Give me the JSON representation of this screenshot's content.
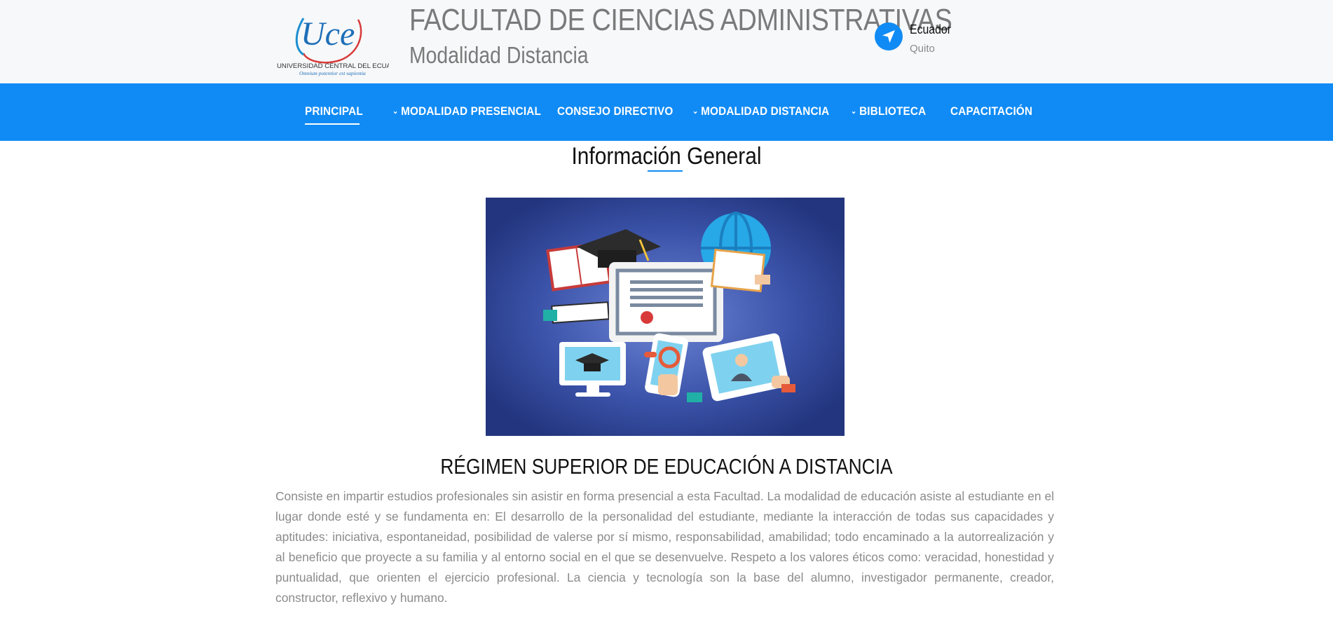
{
  "header": {
    "logo_text": "Uce",
    "logo_caption": "UNIVERSIDAD CENTRAL DEL ECUADOR",
    "logo_motto": "Omnium potentior est sapientia",
    "title": "FACULTAD DE CIENCIAS ADMINISTRATIVAS",
    "subtitle": "Modalidad Distancia",
    "location": {
      "country": "Ecuador",
      "city": "Quito",
      "icon": "navigation-arrow-icon"
    }
  },
  "nav": {
    "items": [
      {
        "label": "PRINCIPAL",
        "active": true,
        "dropdown": false
      },
      {
        "label": "MODALIDAD PRESENCIAL",
        "dropdown": true
      },
      {
        "label": "CONSEJO DIRECTIVO",
        "dropdown": false
      },
      {
        "label": "MODALIDAD DISTANCIA",
        "dropdown": true
      },
      {
        "label": "BIBLIOTECA",
        "dropdown": true
      },
      {
        "label": "CAPACITACIÓN",
        "dropdown": false
      }
    ],
    "chevron": "⌄"
  },
  "main": {
    "section_title": "Información General",
    "regimen_title": "RÉGIMEN SUPERIOR DE EDUCACIÓN A DISTANCIA",
    "paragraph": "Consiste en impartir estudios profesionales sin asistir en forma presencial a esta Facultad. La modalidad de educación asiste al estudiante en el lugar donde esté y se fundamenta en: El desarrollo de la personalidad del estudiante, mediante la interacción de todas sus capacidades y aptitudes: iniciativa, espontaneidad, posibilidad de valerse por sí mismo, responsabilidad, amabilidad; todo encaminado a la autorrealización y al beneficio que proyecte a su familia y al entorno social en el que se desenvuelve. Respeto a los valores éticos como: veracidad, honestidad y puntualidad, que orienten el ejercicio profesional. La ciencia y tecnología son la base del alumno, investigador permanente, creador, constructor, reflexivo y humano."
  },
  "colors": {
    "accent": "#108bf5",
    "topbar": "#f7f8f9",
    "hero_bg": "#2a3d8f",
    "text_muted": "#8b8b8b"
  }
}
